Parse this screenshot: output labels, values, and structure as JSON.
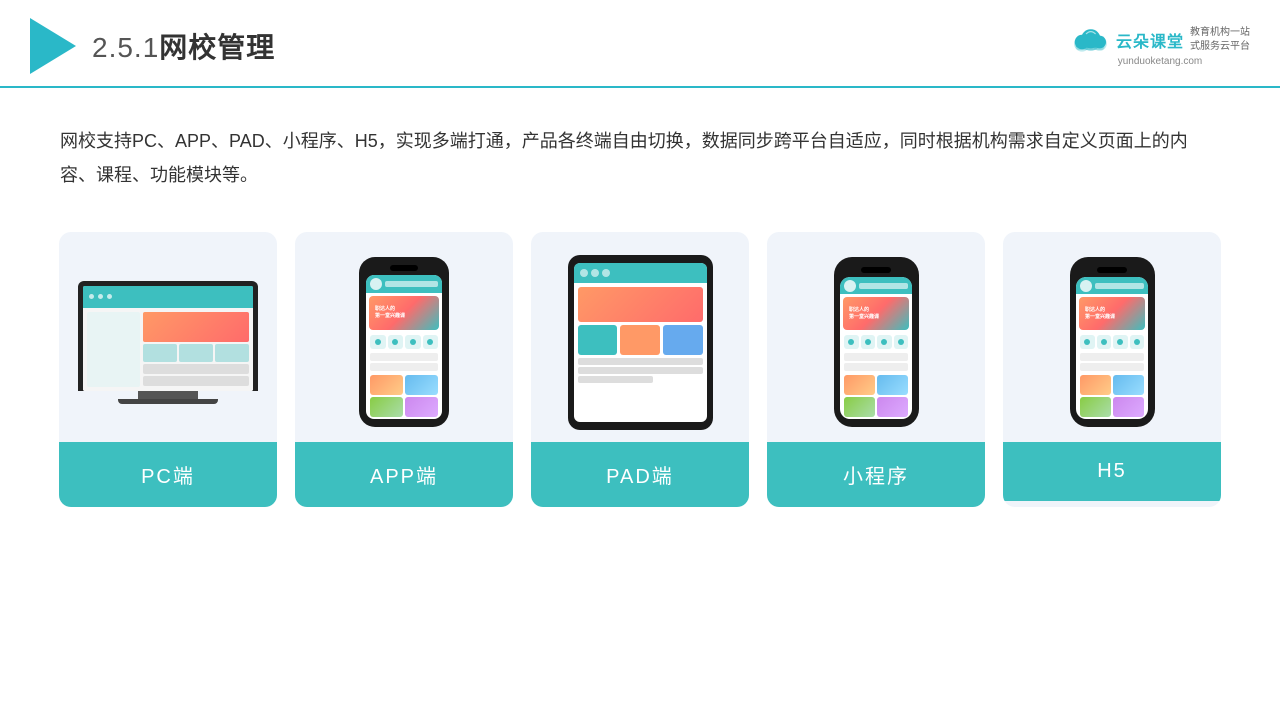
{
  "header": {
    "title_number": "2.5.1",
    "title_text": "网校管理",
    "brand_name": "云朵课堂",
    "brand_domain": "yunduoketang.com",
    "brand_slogan_line1": "教育机构一站",
    "brand_slogan_line2": "式服务云平台"
  },
  "description": {
    "text": "网校支持PC、APP、PAD、小程序、H5，实现多端打通，产品各终端自由切换，数据同步跨平台自适应，同时根据机构需求自定义页面上的内容、课程、功能模块等。"
  },
  "cards": [
    {
      "id": "pc",
      "label": "PC端"
    },
    {
      "id": "app",
      "label": "APP端"
    },
    {
      "id": "pad",
      "label": "PAD端"
    },
    {
      "id": "miniprogram",
      "label": "小程序"
    },
    {
      "id": "h5",
      "label": "H5"
    }
  ]
}
